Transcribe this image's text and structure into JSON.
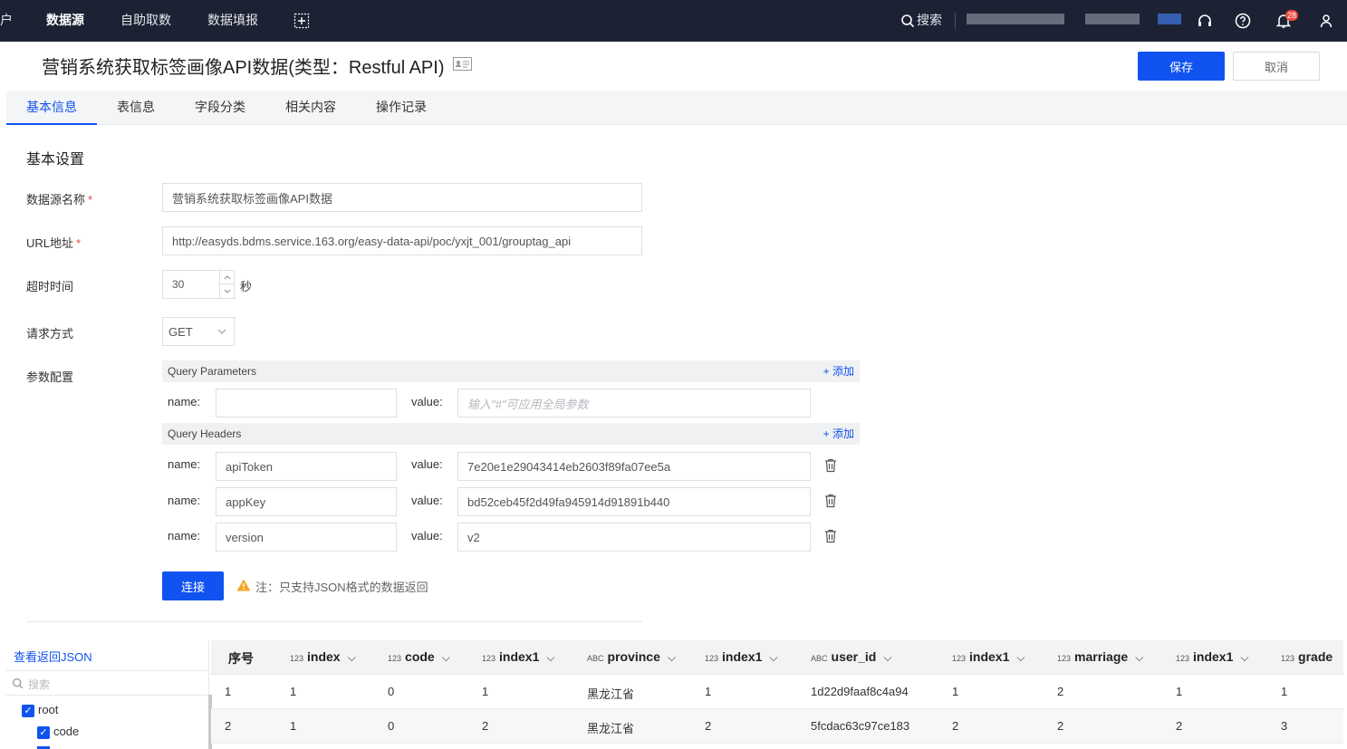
{
  "topbar": {
    "edge_label": "户",
    "nav": [
      "数据源",
      "自助取数",
      "数据填报"
    ],
    "search_label": "搜索",
    "notification_count": "28",
    "icons": [
      "plus-box-icon",
      "search-icon",
      "headset-icon",
      "help-icon",
      "bell-icon",
      "user-icon"
    ]
  },
  "header": {
    "title": "营销系统获取标签画像API数据(类型：Restful API)",
    "save_label": "保存",
    "cancel_label": "取消"
  },
  "tabs": [
    "基本信息",
    "表信息",
    "字段分类",
    "相关内容",
    "操作记录"
  ],
  "form": {
    "section_title": "基本设置",
    "name_label": "数据源名称",
    "name_value": "营销系统获取标签画像API数据",
    "url_label": "URL地址",
    "url_value": "http://easyds.bdms.service.163.org/easy-data-api/poc/yxjt_001/grouptag_api",
    "timeout_label": "超时时间",
    "timeout_value": "30",
    "timeout_unit": "秒",
    "method_label": "请求方式",
    "method_value": "GET",
    "params_label": "参数配置",
    "required_mark": "*"
  },
  "params": {
    "query_params_title": "Query Parameters",
    "query_headers_title": "Query Headers",
    "add_label": "+ 添加",
    "name_key": "name:",
    "value_key": "value:",
    "query_param_value_placeholder": "输入\"#\"可应用全局参数",
    "headers": [
      {
        "name": "apiToken",
        "value": "7e20e1e29043414eb2603f89fa07ee5a"
      },
      {
        "name": "appKey",
        "value": "bd52ceb45f2d49fa945914d91891b440"
      },
      {
        "name": "version",
        "value": "v2"
      }
    ]
  },
  "connect": {
    "button_label": "连接",
    "note": "注：只支持JSON格式的数据返回"
  },
  "tree": {
    "view_json_label": "查看返回JSON",
    "search_placeholder": "搜索",
    "nodes": [
      "root",
      "code"
    ]
  },
  "grid": {
    "columns": [
      {
        "type": "",
        "name": "序号"
      },
      {
        "type": "123",
        "name": "index"
      },
      {
        "type": "123",
        "name": "code"
      },
      {
        "type": "123",
        "name": "index1"
      },
      {
        "type": "ABC",
        "name": "province"
      },
      {
        "type": "123",
        "name": "index1"
      },
      {
        "type": "ABC",
        "name": "user_id"
      },
      {
        "type": "123",
        "name": "index1"
      },
      {
        "type": "123",
        "name": "marriage"
      },
      {
        "type": "123",
        "name": "index1"
      },
      {
        "type": "123",
        "name": "grade"
      }
    ],
    "rows": [
      [
        "1",
        "1",
        "0",
        "1",
        "黑龙江省",
        "1",
        "1d22d9faaf8c4a94",
        "1",
        "2",
        "1",
        "1"
      ],
      [
        "2",
        "1",
        "0",
        "2",
        "黑龙江省",
        "2",
        "5fcdac63c97ce183",
        "2",
        "2",
        "2",
        "3"
      ]
    ]
  },
  "colors": {
    "primary": "#1153f0",
    "topbar": "#1c2233",
    "warning": "#f5a623"
  }
}
